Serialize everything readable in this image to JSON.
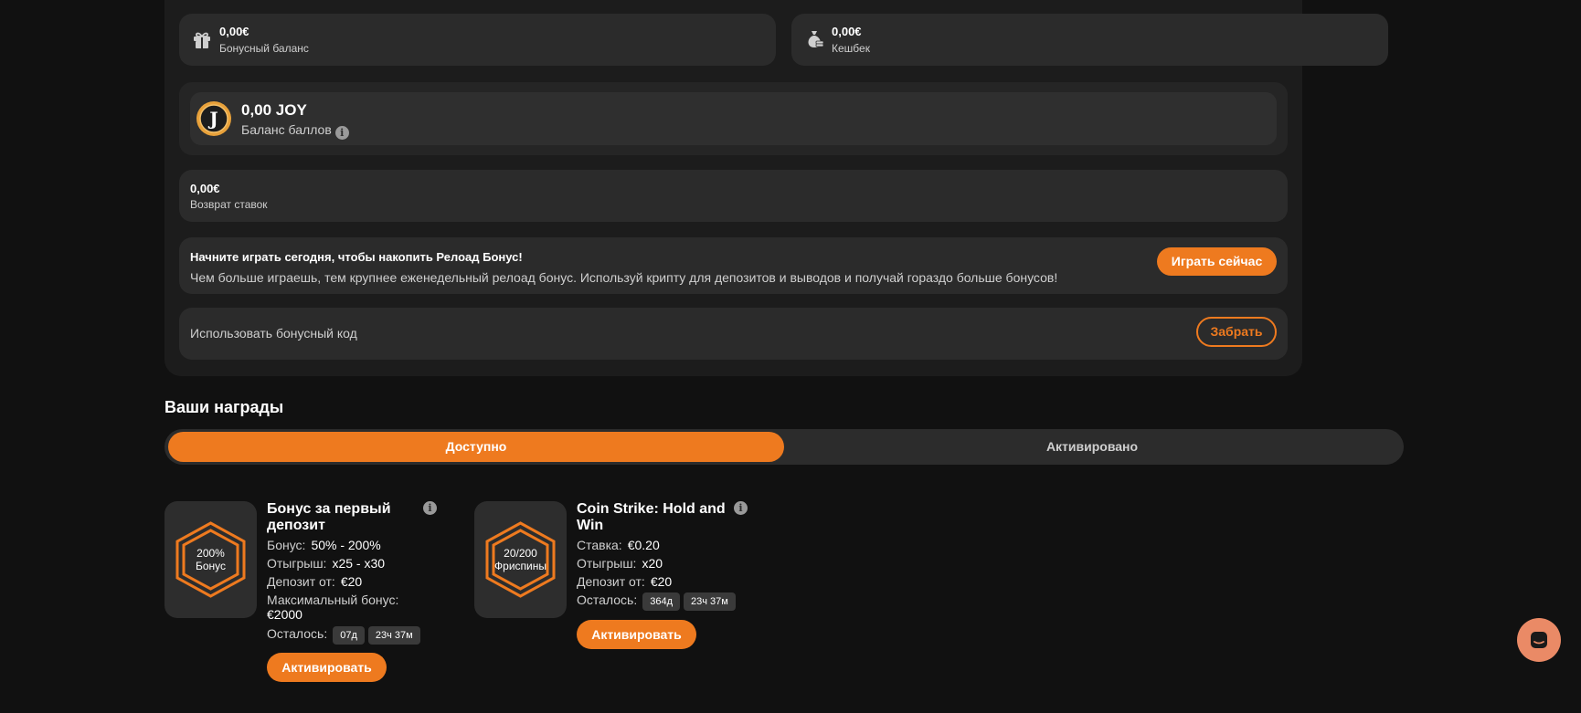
{
  "balances": {
    "bonus": {
      "value": "0,00€",
      "label": "Бонусный баланс",
      "icon": "gift-icon"
    },
    "cashback": {
      "value": "0,00€",
      "label": "Кешбек",
      "icon": "money-bag-icon"
    }
  },
  "points": {
    "value": "0,00 JOY",
    "label": "Баланс баллов",
    "coin_letter": "J",
    "info": "i"
  },
  "bet_return": {
    "value": "0,00€",
    "label": "Возврат ставок"
  },
  "reload": {
    "title": "Начните играть сегодня, чтобы накопить Релоад Бонус!",
    "text": "Чем больше играешь, тем крупнее еженедельный релоад бонус. Используй крипту для депозитов и выводов и получай гораздо больше бонусов!",
    "button": "Играть сейчас"
  },
  "bonus_code": {
    "label": "Использовать бонусный код",
    "button": "Забрать"
  },
  "rewards": {
    "title": "Ваши награды",
    "tabs": [
      {
        "label": "Доступно",
        "active": true
      },
      {
        "label": "Активировано",
        "active": false
      }
    ],
    "offers": [
      {
        "badge_line1": "200%",
        "badge_line2": "Бонус",
        "title": "Бонус за первый депозит",
        "rows": [
          {
            "label": "Бонус:",
            "value": "50% - 200%"
          },
          {
            "label": "Отыгрыш:",
            "value": "x25 - x30"
          },
          {
            "label": "Депозит от:",
            "value": "€20"
          },
          {
            "label": "Максимальный бонус:",
            "value": "€2000"
          }
        ],
        "remaining_label": "Осталось:",
        "remaining": [
          "07д",
          "23ч 37м"
        ],
        "button": "Активировать"
      },
      {
        "badge_line1": "20/200",
        "badge_line2": "Фриспины",
        "title": "Coin Strike: Hold and Win",
        "rows": [
          {
            "label": "Ставка:",
            "value": "€0.20"
          },
          {
            "label": "Отыгрыш:",
            "value": "x20"
          },
          {
            "label": "Депозит от:",
            "value": "€20"
          }
        ],
        "remaining_label": "Осталось:",
        "remaining": [
          "364д",
          "23ч 37м"
        ],
        "button": "Активировать"
      }
    ]
  },
  "colors": {
    "accent": "#ee7a1f",
    "background": "#111111",
    "card": "#2b2b2b",
    "chat": "#ea8a66"
  }
}
